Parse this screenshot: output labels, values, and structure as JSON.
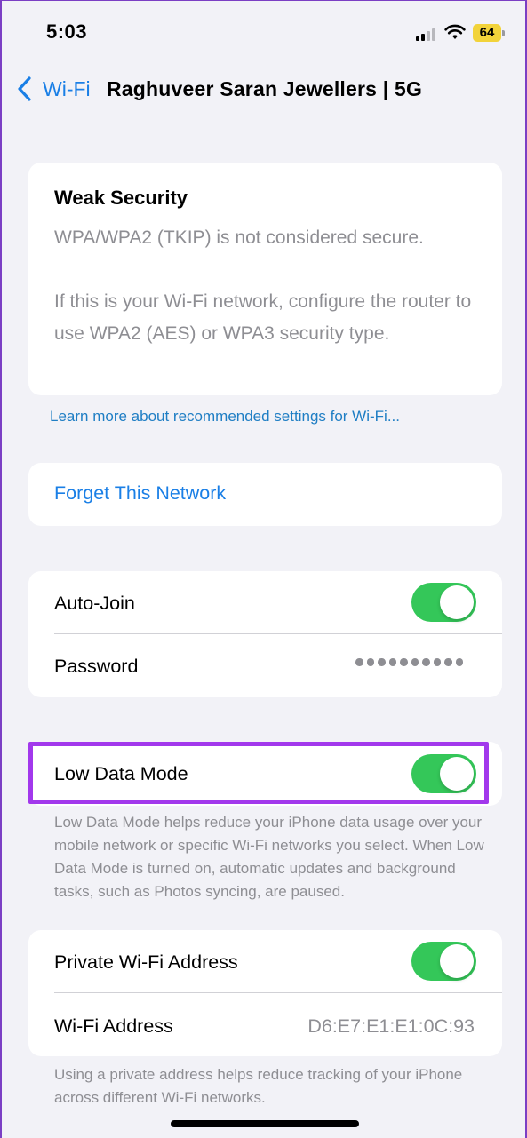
{
  "status_bar": {
    "time": "5:03",
    "battery_level": "64",
    "battery_color": "#f2d33a"
  },
  "nav": {
    "back_label": "Wi-Fi",
    "title": "Raghuveer Saran Jewellers | 5G"
  },
  "security_warning": {
    "title": "Weak Security",
    "line1": "WPA/WPA2 (TKIP) is not considered secure.",
    "line2": "If this is your Wi-Fi network, configure the router to use WPA2 (AES) or WPA3 security type."
  },
  "learn_more_link": "Learn more about recommended settings for Wi-Fi...",
  "forget_network": "Forget This Network",
  "auto_join": {
    "label": "Auto-Join",
    "on": true
  },
  "password": {
    "label": "Password",
    "masked_length": 10
  },
  "low_data_mode": {
    "label": "Low Data Mode",
    "on": true,
    "footnote": "Low Data Mode helps reduce your iPhone data usage over your mobile network or specific Wi-Fi networks you select. When Low Data Mode is turned on, automatic updates and background tasks, such as Photos syncing, are paused."
  },
  "private_address": {
    "label": "Private Wi-Fi Address",
    "on": true,
    "address_label": "Wi-Fi Address",
    "address_value": "D6:E7:E1:E1:0C:93",
    "footnote": "Using a private address helps reduce tracking of your iPhone across different Wi-Fi networks."
  },
  "colors": {
    "accent": "#1a7fe6",
    "toggle_on": "#34c759",
    "highlight": "#a238ec"
  }
}
